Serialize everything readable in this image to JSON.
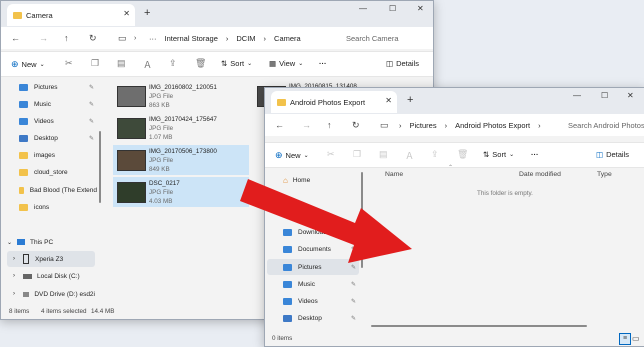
{
  "win1": {
    "tab_title": "Camera",
    "path": [
      "Internal Storage",
      "DCIM",
      "Camera"
    ],
    "more_crumb": "···",
    "search_placeholder": "Search Camera",
    "toolbar": {
      "new": "New",
      "sort": "Sort",
      "view": "View",
      "more": "···",
      "details": "Details"
    },
    "sidebar": [
      {
        "label": "Pictures",
        "icon": "folder-pictures-icon",
        "pinned": true
      },
      {
        "label": "Music",
        "icon": "folder-music-icon",
        "pinned": true
      },
      {
        "label": "Videos",
        "icon": "folder-videos-icon",
        "pinned": true
      },
      {
        "label": "Desktop",
        "icon": "folder-desktop-icon",
        "pinned": true
      },
      {
        "label": "images",
        "icon": "folder-icon",
        "pinned": false
      },
      {
        "label": "cloud_store",
        "icon": "folder-icon",
        "pinned": false
      },
      {
        "label": "Bad Blood (The Extend",
        "icon": "folder-icon",
        "pinned": false
      },
      {
        "label": "icons",
        "icon": "folder-icon",
        "pinned": false
      }
    ],
    "tree": [
      {
        "label": "This PC",
        "icon": "pc-icon",
        "expanded": true
      },
      {
        "label": "Xperia Z3",
        "icon": "phone-icon",
        "selected": true
      },
      {
        "label": "Local Disk (C:)",
        "icon": "drive-icon"
      },
      {
        "label": "DVD Drive (D:) esd2i",
        "icon": "dvd-icon"
      }
    ],
    "files": [
      {
        "name": "IMG_20160802_120051",
        "type": "JPG File",
        "size": "863 KB",
        "selected": false
      },
      {
        "name": "IMG_20170424_175647",
        "type": "JPG File",
        "size": "1.07 MB",
        "selected": false
      },
      {
        "name": "IMG_20170506_173800",
        "type": "JPG File",
        "size": "849 KB",
        "selected": true
      },
      {
        "name": "DSC_0217",
        "type": "JPG File",
        "size": "4.03 MB",
        "selected": true
      }
    ],
    "files_col2": [
      {
        "name": "IMG_20160815_131408"
      }
    ],
    "status_count": "8 items",
    "status_selected": "4 items selected",
    "status_size": "14.4 MB"
  },
  "win2": {
    "tab_title": "Android Photos Export",
    "path": [
      "Pictures",
      "Android Photos Export"
    ],
    "search_placeholder": "Search Android Photos",
    "toolbar": {
      "new": "New",
      "sort": "Sort",
      "more": "···",
      "details": "Details"
    },
    "sidebar_home": "Home",
    "sidebar": [
      {
        "label": "Downloads",
        "icon": "folder-downloads-icon",
        "pinned": true,
        "selected": false
      },
      {
        "label": "Documents",
        "icon": "folder-documents-icon",
        "pinned": true,
        "selected": false
      },
      {
        "label": "Pictures",
        "icon": "folder-pictures-icon",
        "pinned": true,
        "selected": true
      },
      {
        "label": "Music",
        "icon": "folder-music-icon",
        "pinned": true,
        "selected": false
      },
      {
        "label": "Videos",
        "icon": "folder-videos-icon",
        "pinned": true,
        "selected": false
      },
      {
        "label": "Desktop",
        "icon": "folder-desktop-icon",
        "pinned": true,
        "selected": false
      }
    ],
    "columns": [
      "Name",
      "Date modified",
      "Type"
    ],
    "empty_message": "This folder is empty.",
    "status_count": "0 items"
  },
  "colors": {
    "arrow": "#e11d1d",
    "selection": "#cce4f7",
    "accent": "#0067c0"
  }
}
